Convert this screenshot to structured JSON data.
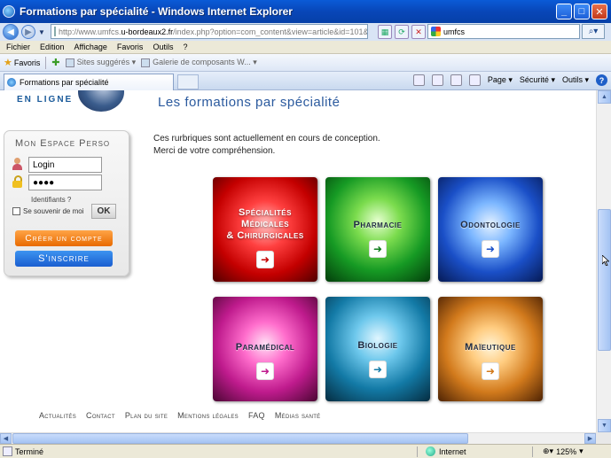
{
  "window": {
    "title": "Formations par spécialité - Windows Internet Explorer",
    "minimize": "_",
    "maximize": "□",
    "close": "✕"
  },
  "address": {
    "url_prefix": "http://www.umfcs.",
    "url_domain": "u-bordeaux2.fr",
    "url_rest": "/index.php?option=com_content&view=article&id=101&Itemid=58",
    "search_value": "umfcs"
  },
  "menu": [
    "Fichier",
    "Edition",
    "Affichage",
    "Favoris",
    "Outils",
    "?"
  ],
  "favorites": {
    "label": "Favoris",
    "items": [
      "Sites suggérés ▾",
      "Galerie de composants W... ▾"
    ]
  },
  "tab": {
    "label": "Formations par spécialité"
  },
  "commands": {
    "page": "Page ▾",
    "security": "Sécurité ▾",
    "tools": "Outils ▾",
    "help": "?"
  },
  "site": {
    "logo_text": "EN LIGNE",
    "page_title": "Les formations par spécialité",
    "message_line1": "Ces rurbriques sont actuellement en cours de conception.",
    "message_line2": "Merci de votre compréhension."
  },
  "perso": {
    "title": "Mon Espace Perso",
    "login_value": "Login",
    "password_value": "●●●●",
    "identifiants": "Identifiants ?",
    "remember": "Se souvenir de moi",
    "ok": "OK",
    "create": "Créer un compte",
    "subscribe": "S'inscrire"
  },
  "tiles": [
    {
      "label": "Spécialités\nMédicales\n& Chirurgicales",
      "arrow": "➜"
    },
    {
      "label": "Pharmacie",
      "arrow": "➜"
    },
    {
      "label": "Odontologie",
      "arrow": "➜"
    },
    {
      "label": "Paramédical",
      "arrow": "➜"
    },
    {
      "label": "Biologie",
      "arrow": "➜"
    },
    {
      "label": "Maïeutique",
      "arrow": "➜"
    }
  ],
  "footer": [
    "Actualités",
    "Contact",
    "Plan du site",
    "Mentions légales",
    "FAQ",
    "Médias santé"
  ],
  "status": {
    "text": "Terminé",
    "zone": "Internet",
    "zoom": "125%"
  },
  "colors": {
    "titlebar": "#0846b8",
    "title_text": "#2b5a9e",
    "create_button": "#e86a00",
    "subscribe_button": "#1a5ed0"
  }
}
